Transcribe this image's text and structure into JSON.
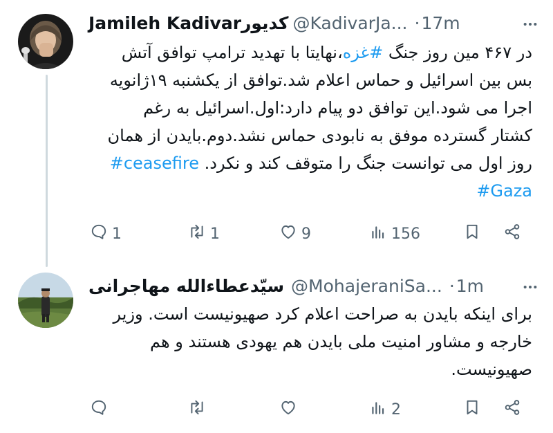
{
  "tweets": [
    {
      "author": {
        "name": "Jamileh Kadivarکدیور",
        "handle": "@KadivarJa...",
        "time": "17m"
      },
      "text_parts": [
        {
          "text": "در ۴۶۷ مین روز جنگ ",
          "type": "plain"
        },
        {
          "text": "#غزه",
          "type": "hashtag"
        },
        {
          "text": "،نهایتا با تهدید ترامپ توافق آتش بس بین اسرائیل و حماس اعلام شد.توافق از یکشنبه ۱۹ژانویه اجرا می شود.این توافق دو پیام دارد:اول.اسرائیل به رغم کشتار گسترده موفق به نابودی حماس نشد.دوم.بایدن از همان روز اول می توانست جنگ را متوقف کند و نکرد. ",
          "type": "plain"
        },
        {
          "text": "#ceasefire",
          "type": "hashtag"
        },
        {
          "text": " ",
          "type": "plain"
        },
        {
          "text": "#Gaza",
          "type": "hashtag"
        }
      ],
      "stats": {
        "replies": "1",
        "retweets": "1",
        "likes": "9",
        "views": "156"
      }
    },
    {
      "author": {
        "name": "سیّدعطاءالله مهاجرانی",
        "handle": "@MohajeraniSa...",
        "time": "1m"
      },
      "text": "برای اینکه بایدن به صراحت اعلام کرد صهیونیست است. وزیر خارجه و مشاور امنیت ملی بایدن هم یهودی هستند و هم صهیونیست.",
      "stats": {
        "replies": "",
        "retweets": "",
        "likes": "",
        "views": "2"
      }
    }
  ],
  "separator": "·",
  "colors": {
    "text": "#0f1419",
    "secondary": "#536471",
    "link": "#1d9bf0",
    "thread_line": "#cfd9de"
  },
  "icons": [
    "reply-icon",
    "retweet-icon",
    "like-icon",
    "views-icon",
    "bookmark-icon",
    "share-icon",
    "more-icon"
  ]
}
